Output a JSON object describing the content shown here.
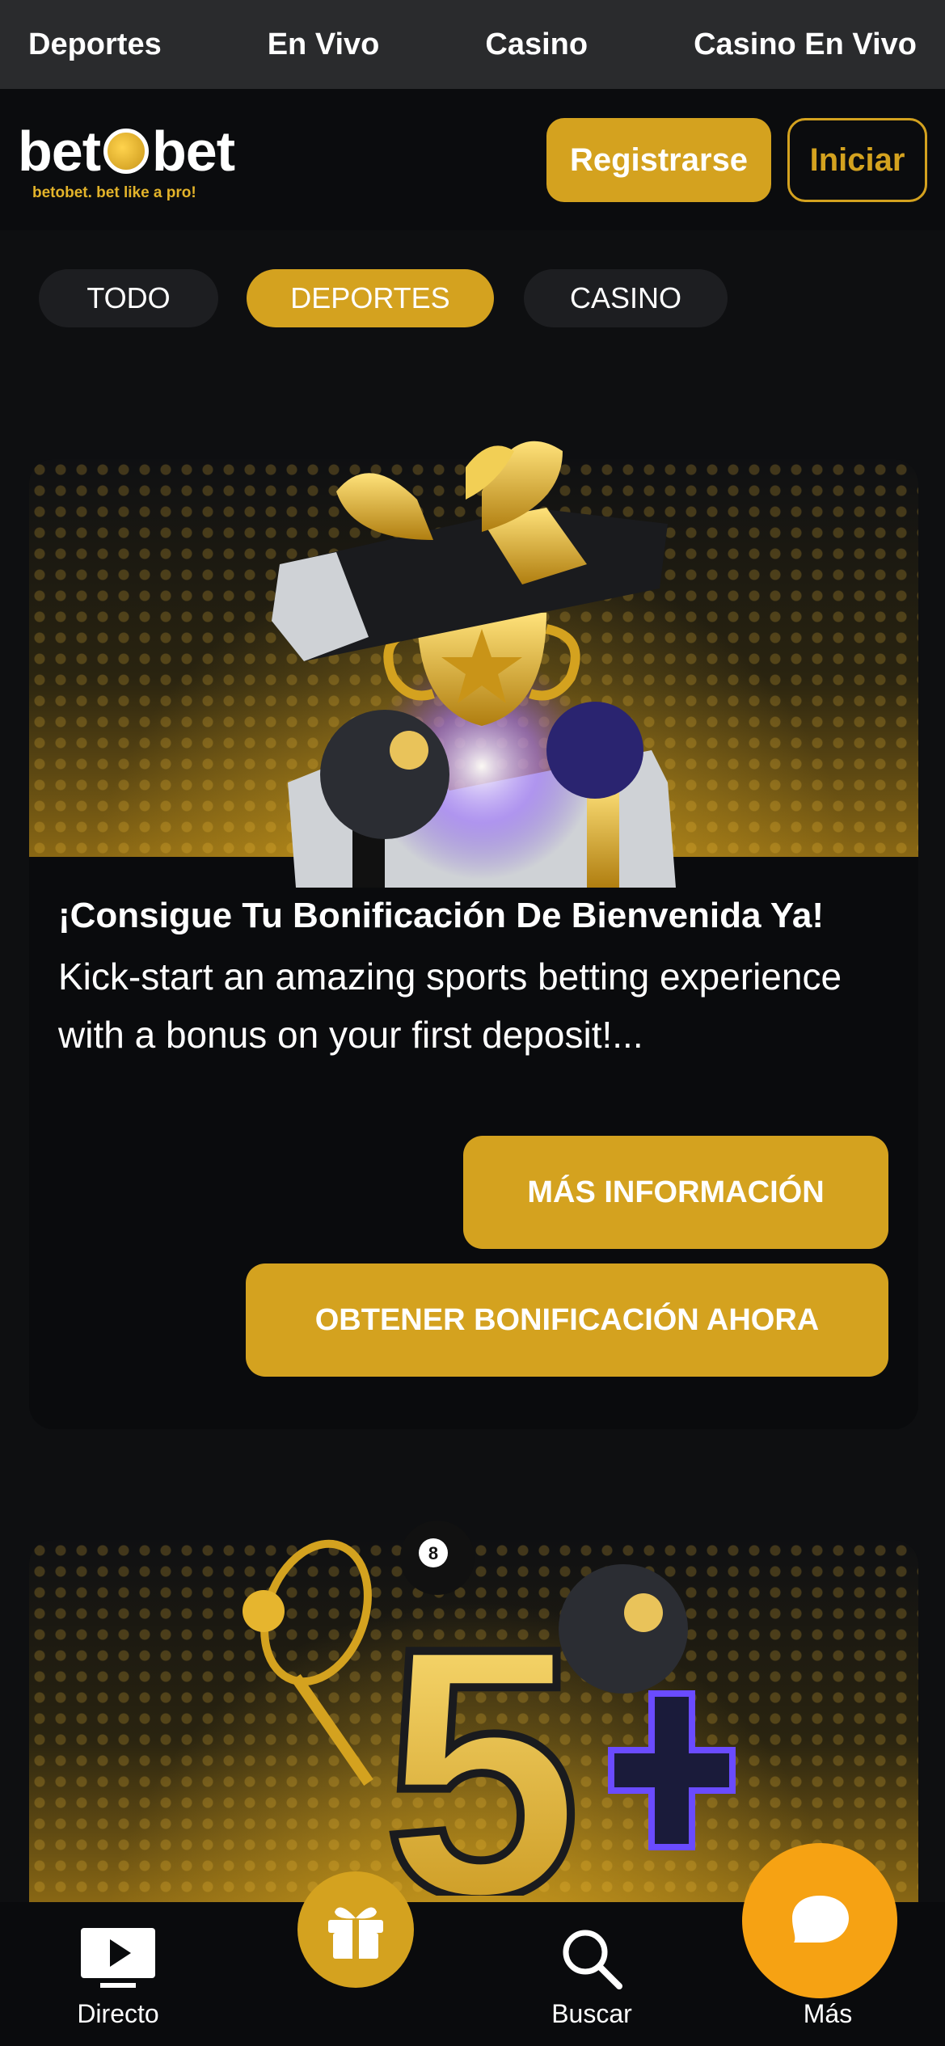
{
  "topnav": {
    "items": [
      "Deportes",
      "En Vivo",
      "Casino",
      "Casino En Vivo"
    ]
  },
  "header": {
    "logo_text_left": "bet",
    "logo_text_right": "bet",
    "logo_tagline": "betobet. bet like a pro!",
    "register_label": "Registrarse",
    "login_label": "Iniciar"
  },
  "filters": {
    "tabs": [
      "TODO",
      "DEPORTES",
      "CASINO"
    ],
    "active": "DEPORTES"
  },
  "promo1": {
    "title": "¡Consigue Tu Bonificación De Bienvenida Ya!",
    "text": "Kick-start an amazing sports betting experience with a bonus on your first deposit!...",
    "info_label": "MÁS INFORMACIÓN",
    "bonus_label": "OBTENER BONIFICACIÓN AHORA"
  },
  "promo2": {
    "badge_number": "5",
    "ball_number": "8"
  },
  "bottomnav": {
    "items": [
      {
        "label": "Directo",
        "icon": "tv-play-icon"
      },
      {
        "label": "Buscar",
        "icon": "search-icon"
      },
      {
        "label": "Más",
        "icon": "more-icon"
      }
    ],
    "gift_icon": "gift-icon",
    "chat_icon": "chat-icon"
  },
  "colors": {
    "accent": "#d4a21f",
    "chat": "#f6a213",
    "topnav_bg": "#2a2b2d",
    "page_bg": "#0e0f11"
  }
}
